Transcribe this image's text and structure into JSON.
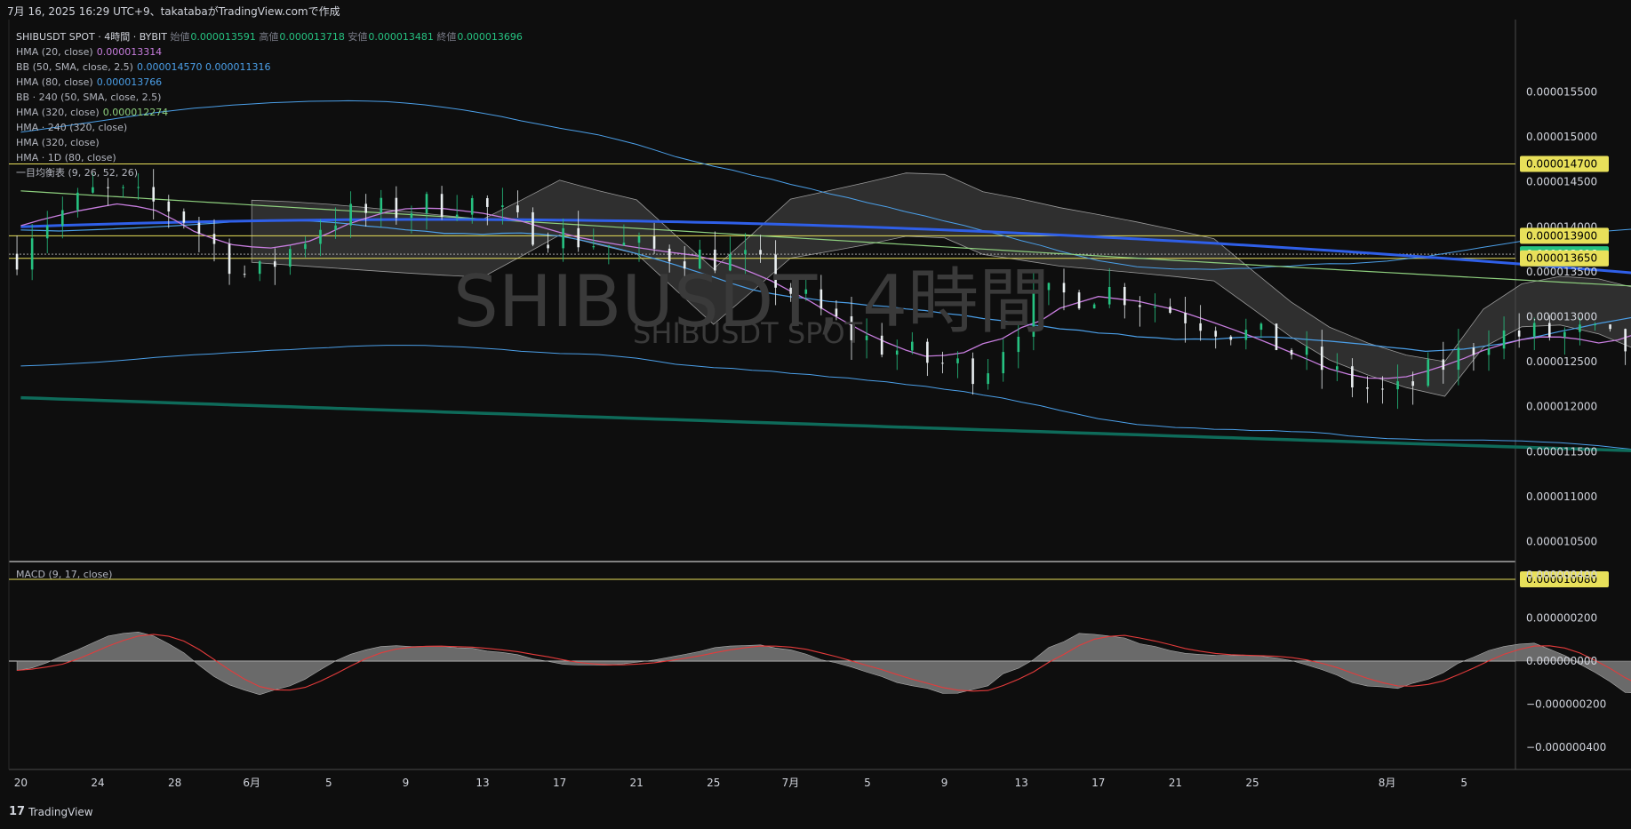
{
  "header": {
    "caption": "7月 16, 2025 16:29 UTC+9、takatabaがTradingView.comで作成"
  },
  "legend": {
    "symbol_line": {
      "symbol": "SHIBUSDT SPOT · 4時間 · BYBIT",
      "open_label": "始値",
      "open": "0.000013591",
      "high_label": "高値",
      "high": "0.000013718",
      "low_label": "安値",
      "low": "0.000013481",
      "close_label": "終値",
      "close": "0.000013696"
    },
    "indicators": [
      {
        "name": "HMA (20, close)",
        "value": "0.000013314",
        "color": "#c77dde"
      },
      {
        "name": "BB (50, SMA, close, 2.5)",
        "value": "0.000014570  0.000011316",
        "color": "#4b9fe8"
      },
      {
        "name": "HMA (80, close)",
        "value": "0.000013766",
        "color": "#4b9fe8"
      },
      {
        "name": "BB · 240 (50, SMA, close, 2.5)",
        "value": "",
        "color": "#d1d4dc"
      },
      {
        "name": "HMA (320, close)",
        "value": "0.000012274",
        "color": "#8fd17f"
      },
      {
        "name": "HMA · 240 (320, close)",
        "value": "",
        "color": "#d1d4dc"
      },
      {
        "name": "HMA (320, close)",
        "value": "",
        "color": "#d1d4dc"
      },
      {
        "name": "HMA · 1D (80, close)",
        "value": "",
        "color": "#d1d4dc"
      },
      {
        "name": "一目均衡表 (9, 26, 52, 26)",
        "value": "",
        "color": "#d1d4dc"
      }
    ]
  },
  "watermark": {
    "main": "SHIBUSDT, 4時間",
    "sub": "SHIBUSDT SPOT"
  },
  "macd_label": "MACD (9, 17, close)",
  "footer": {
    "brand": "TradingView",
    "logo": "17"
  },
  "colors": {
    "up": "#26c281",
    "down": "#e9eef0",
    "hma20": "#c77dde",
    "bb": "#4b9fe8",
    "hma80": "#2f5fe8",
    "hma320": "#8fd17f",
    "hma1d": "#0e6b5a",
    "hline": "#e8e05a",
    "signal": "#e33b3b"
  },
  "chart_data": [
    {
      "type": "candlestick",
      "title": "SHIBUSDT SPOT · 4時間 · BYBIT",
      "x_ticks": [
        "20",
        "24",
        "28",
        "6月",
        "5",
        "9",
        "13",
        "17",
        "21",
        "25",
        "7月",
        "5",
        "9",
        "13",
        "17",
        "21",
        "25",
        "8月",
        "5"
      ],
      "y_ticks": [
        "0.000015500",
        "0.000015000",
        "0.000014500",
        "0.000014000",
        "0.000013500",
        "0.000013000",
        "0.000012500",
        "0.000012000",
        "0.000011500",
        "0.000011000",
        "0.000010500"
      ],
      "ylim": [
        1e-05,
        1.58e-05
      ],
      "price_labels": [
        {
          "text": "0.000014700",
          "value": 1.47e-05,
          "kind": "hline"
        },
        {
          "text": "0.000013900",
          "value": 1.39e-05,
          "kind": "hline"
        },
        {
          "text": "0.000013696",
          "value": 1.3696e-05,
          "kind": "last"
        },
        {
          "text": "0.000013650",
          "value": 1.365e-05,
          "kind": "hline"
        },
        {
          "text": "0.000010080",
          "value": 1.008e-05,
          "kind": "hline"
        }
      ],
      "series": [
        {
          "name": "HMA (20, close)",
          "style": "line"
        },
        {
          "name": "BB (50, SMA, close, 2.5)",
          "style": "band"
        },
        {
          "name": "HMA (80, close)",
          "style": "line"
        },
        {
          "name": "HMA (320, close)",
          "style": "line"
        },
        {
          "name": "HMA · 1D (80, close)",
          "style": "line"
        },
        {
          "name": "一目均衡表 (9, 26, 52, 26)",
          "style": "cloud"
        }
      ],
      "grid": false
    },
    {
      "type": "area",
      "title": "MACD (9, 17, close)",
      "y_ticks": [
        "0.000000400",
        "0.000000200",
        "0.000000000",
        "−0.000000200",
        "−0.000000400"
      ],
      "ylim": [
        -4.5e-07,
        4.5e-07
      ]
    }
  ]
}
